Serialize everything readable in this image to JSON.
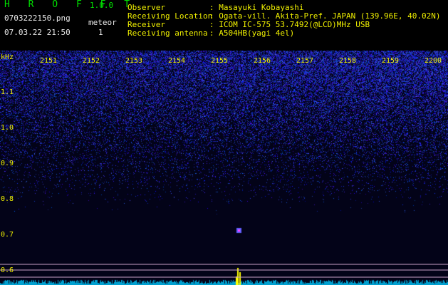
{
  "header": {
    "app_title": "H R O F F T",
    "version": "1.0.0",
    "filename": "0703222150.png",
    "datetime": "07.03.22 21:50",
    "meteor_label": "meteor",
    "meteor_count": "1",
    "info": [
      {
        "label": "Observer",
        "value": ": Masayuki Kobayashi"
      },
      {
        "label": "Receiving Location",
        "value": ": Ogata-vill. Akita-Pref. JAPAN (139.96E, 40.02N)"
      },
      {
        "label": "Receiver",
        "value": ": ICOM IC-575 53.7492(@LCD)MHz USB"
      },
      {
        "label": "Receiving antenna",
        "value": ": A504HB(yagi 4el)"
      }
    ]
  },
  "plot": {
    "y_unit": "kHz",
    "y_ticks": [
      "1.1",
      "1.0",
      "0.9",
      "0.8",
      "0.7",
      "0.6"
    ],
    "x_ticks": [
      "2151",
      "2152",
      "2153",
      "2154",
      "2155",
      "2156",
      "2157",
      "2158",
      "2159",
      "2200"
    ]
  },
  "colors": {
    "header_text": "#f0f000",
    "title_text": "#00e000",
    "noise": "#3a4cff",
    "background": "#030318"
  }
}
